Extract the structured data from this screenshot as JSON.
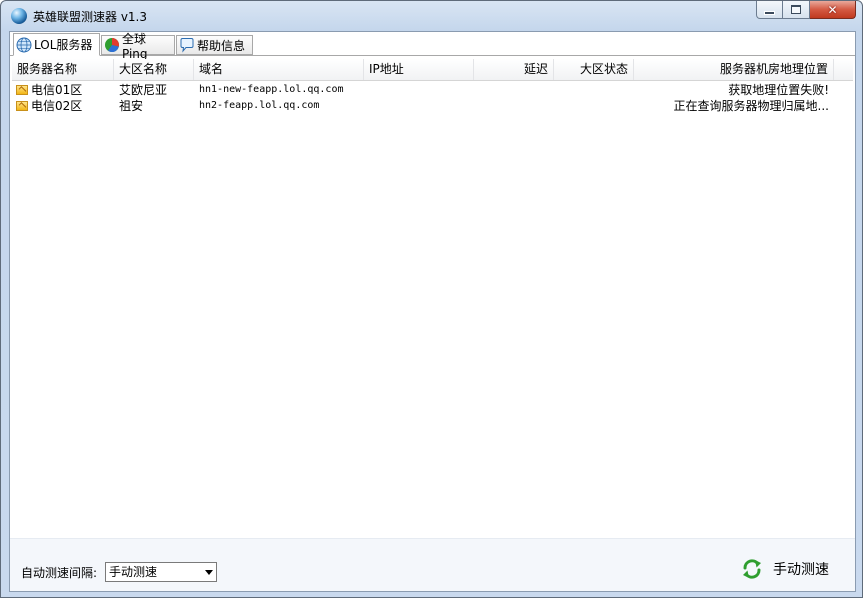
{
  "window": {
    "title": "英雄联盟测速器 v1.3",
    "close_glyph": "✕"
  },
  "tabs": [
    {
      "label": "LOL服务器",
      "icon": "globe-icon",
      "active": true
    },
    {
      "label": "全球Ping",
      "icon": "pie-chart-icon",
      "active": false
    },
    {
      "label": "帮助信息",
      "icon": "speech-bubble-icon",
      "active": false
    }
  ],
  "table": {
    "columns": [
      "服务器名称",
      "大区名称",
      "域名",
      "IP地址",
      "延迟",
      "大区状态",
      "服务器机房地理位置"
    ],
    "rows": [
      {
        "name": "电信01区",
        "region": "艾欧尼亚",
        "domain": "hn1-new-feapp.lol.qq.com",
        "ip": "",
        "latency": "",
        "status": "",
        "location": "获取地理位置失败!"
      },
      {
        "name": "电信02区",
        "region": "祖安",
        "domain": "hn2-feapp.lol.qq.com",
        "ip": "",
        "latency": "",
        "status": "",
        "location": "正在查询服务器物理归属地..."
      }
    ]
  },
  "bottom": {
    "interval_label": "自动测速间隔:",
    "interval_value": "手动测速",
    "manual_button": "手动测速"
  },
  "colors": {
    "accent": "#2f9e2f",
    "close_button": "#c0391f"
  }
}
